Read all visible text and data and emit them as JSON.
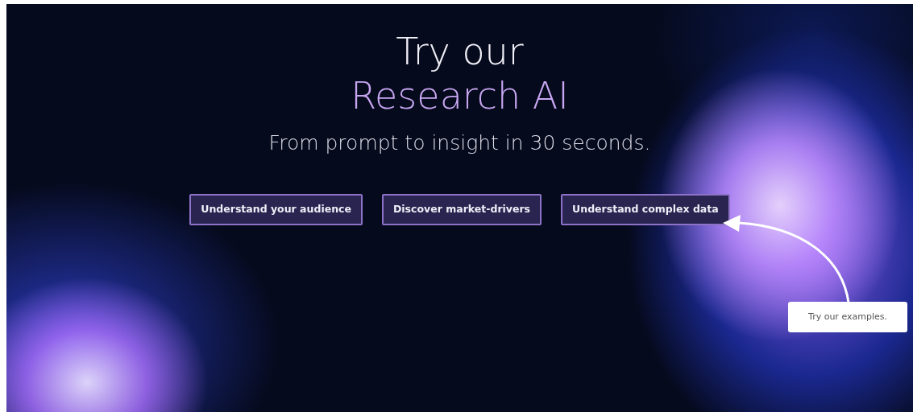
{
  "hero": {
    "title_line_1": "Try our",
    "title_line_2": "Research AI",
    "subtitle": "From prompt to insight in 30 seconds."
  },
  "example_buttons": [
    "Understand your audience",
    "Discover market-drivers",
    "Understand complex data"
  ],
  "callout": {
    "text": "Try our examples."
  }
}
